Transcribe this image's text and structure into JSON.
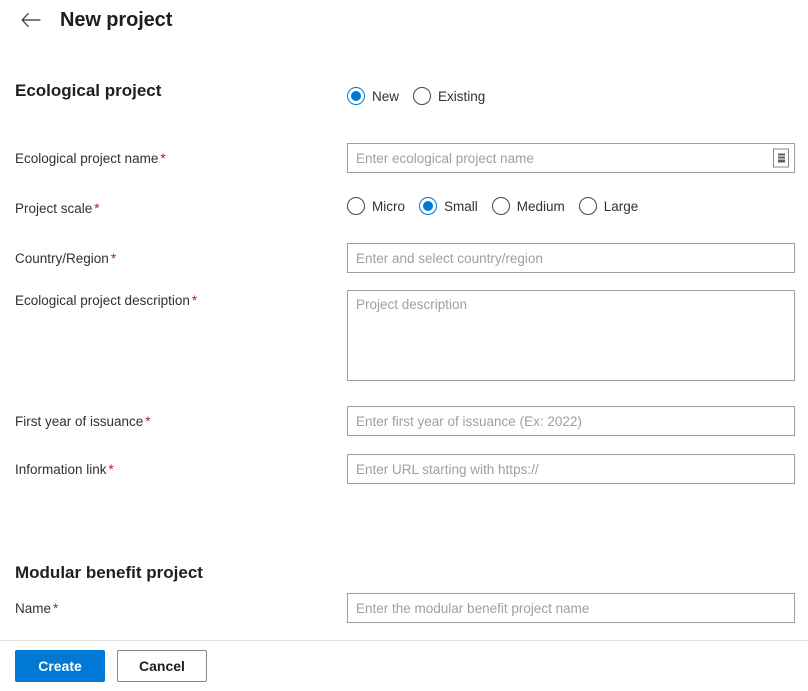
{
  "header": {
    "back_icon": "arrow-left-icon",
    "title": "New project"
  },
  "sections": {
    "ecological": {
      "title": "Ecological project",
      "mode_radio": {
        "name": "ecological-project-mode",
        "options": [
          {
            "label": "New",
            "selected": true
          },
          {
            "label": "Existing",
            "selected": false
          }
        ]
      },
      "fields": {
        "project_name": {
          "label": "Ecological project name",
          "required": "*",
          "placeholder": "Enter ecological project name",
          "value": "",
          "picker_icon": "list-picker-icon"
        },
        "project_scale": {
          "label": "Project scale",
          "required": "*",
          "options": [
            {
              "label": "Micro",
              "selected": false
            },
            {
              "label": "Small",
              "selected": true
            },
            {
              "label": "Medium",
              "selected": false
            },
            {
              "label": "Large",
              "selected": false
            }
          ]
        },
        "country_region": {
          "label": "Country/Region",
          "required": "*",
          "placeholder": "Enter and select country/region",
          "value": ""
        },
        "description": {
          "label": "Ecological project description",
          "required": "*",
          "placeholder": "Project description",
          "value": ""
        },
        "first_year": {
          "label": "First year of issuance",
          "required": "*",
          "placeholder": "Enter first year of issuance (Ex: 2022)",
          "value": ""
        },
        "information_link": {
          "label": "Information link",
          "required": "*",
          "placeholder": "Enter URL starting with https://",
          "value": ""
        }
      }
    },
    "modular": {
      "title": "Modular benefit project",
      "fields": {
        "name": {
          "label": "Name",
          "required": "*",
          "placeholder": "Enter the modular benefit project name",
          "value": ""
        }
      }
    }
  },
  "footer": {
    "create_label": "Create",
    "cancel_label": "Cancel"
  },
  "colors": {
    "accent": "#0078d4",
    "required_asterisk": "#a4262c",
    "input_border": "#a19f9d",
    "divider": "#e1dfdd",
    "text": "#201f1e"
  }
}
